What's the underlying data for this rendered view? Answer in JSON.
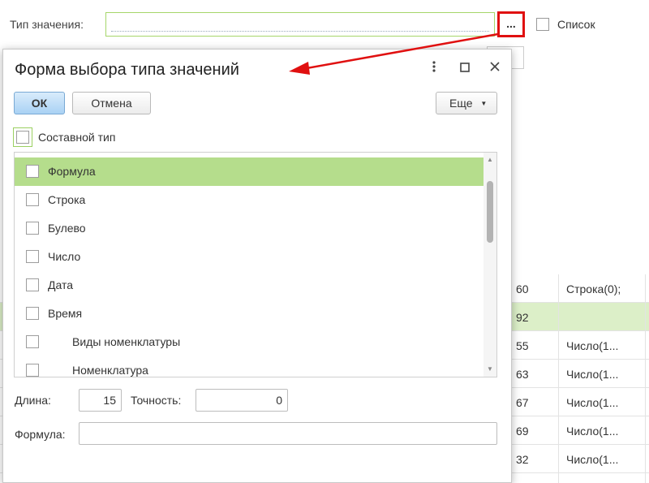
{
  "background": {
    "value_type_label": "Тип значения:",
    "ellipsis_button": "...",
    "list_checkbox_label": "Список",
    "table_rows": [
      {
        "col1": "60",
        "col2": "Строка(0);",
        "selected": false
      },
      {
        "col1": "92",
        "col2": "",
        "selected": true
      },
      {
        "col1": "55",
        "col2": "Число(1...",
        "selected": false
      },
      {
        "col1": "63",
        "col2": "Число(1...",
        "selected": false
      },
      {
        "col1": "67",
        "col2": "Число(1...",
        "selected": false
      },
      {
        "col1": "69",
        "col2": "Число(1...",
        "selected": false
      },
      {
        "col1": "32",
        "col2": "Число(1...",
        "selected": false
      }
    ]
  },
  "dialog": {
    "title": "Форма выбора типа значений",
    "ok_label": "ОК",
    "cancel_label": "Отмена",
    "more_label": "Еще",
    "composite_type_label": "Составной тип",
    "items": [
      {
        "label": "Формула",
        "selected": true,
        "indent": false
      },
      {
        "label": "Строка",
        "selected": false,
        "indent": false
      },
      {
        "label": "Булево",
        "selected": false,
        "indent": false
      },
      {
        "label": "Число",
        "selected": false,
        "indent": false
      },
      {
        "label": "Дата",
        "selected": false,
        "indent": false
      },
      {
        "label": "Время",
        "selected": false,
        "indent": false
      },
      {
        "label": "Виды номенклатуры",
        "selected": false,
        "indent": true
      },
      {
        "label": "Номенклатура",
        "selected": false,
        "indent": true
      }
    ],
    "length_label": "Длина:",
    "length_value": "15",
    "precision_label": "Точность:",
    "precision_value": "0",
    "formula_label": "Формула:",
    "formula_value": ""
  },
  "colors": {
    "selection_green": "#b5dd8c",
    "highlight_red": "#e01010",
    "ok_blue": "#a9d2f4"
  }
}
